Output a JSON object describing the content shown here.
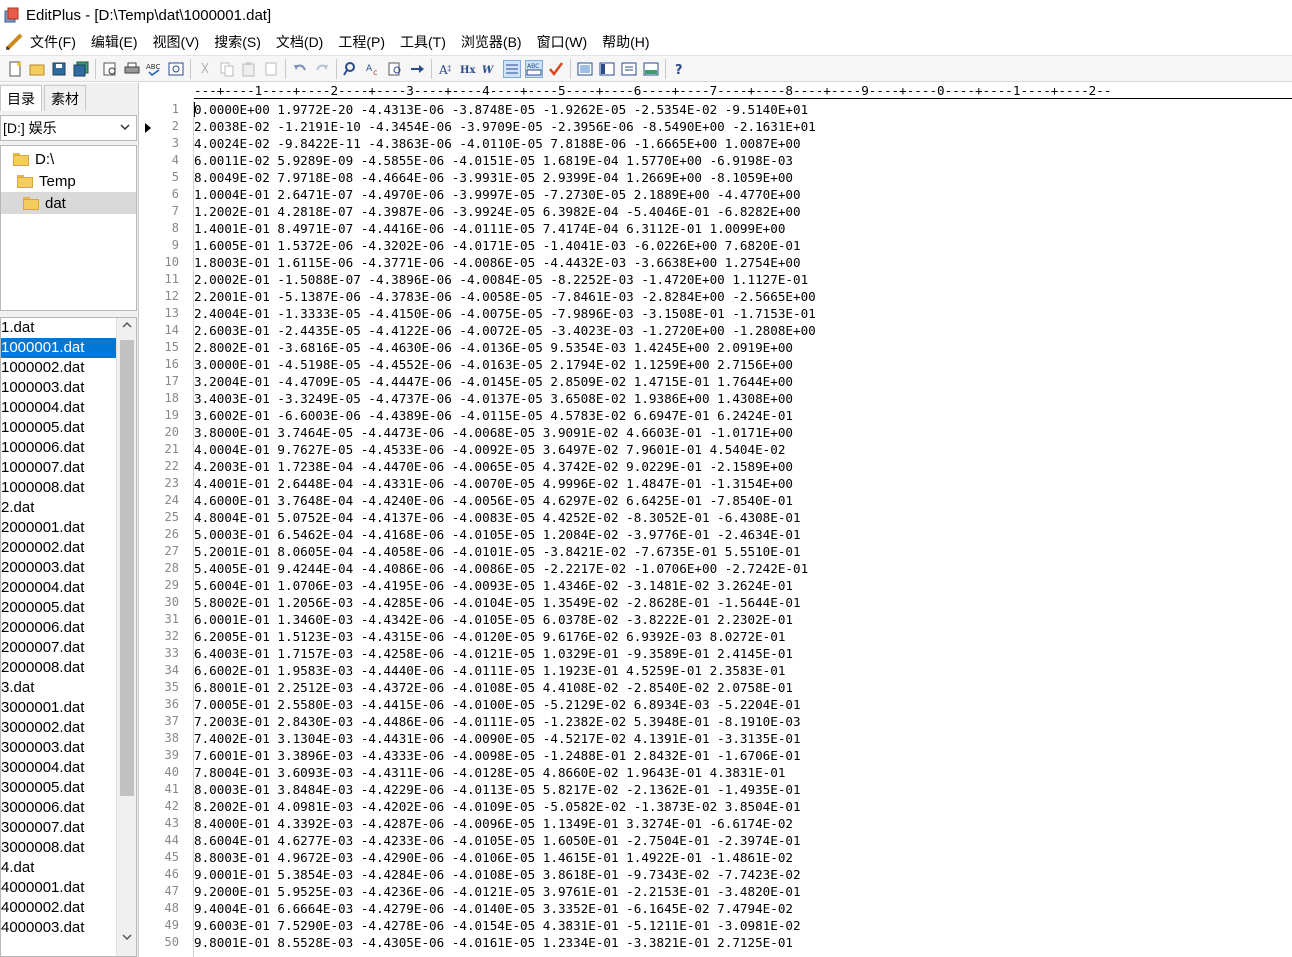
{
  "window": {
    "title": "EditPlus - [D:\\Temp\\dat\\1000001.dat]"
  },
  "menu": [
    "文件(F)",
    "编辑(E)",
    "视图(V)",
    "搜索(S)",
    "文档(D)",
    "工程(P)",
    "工具(T)",
    "浏览器(B)",
    "窗口(W)",
    "帮助(H)"
  ],
  "toolbar": {
    "buttons": [
      "new-icon",
      "open-icon",
      "save-icon",
      "save-all-icon",
      "print-preview-icon",
      "print-icon",
      "spellcheck-icon",
      "browser-icon",
      "cut-icon",
      "copy-icon",
      "paste-icon",
      "delete-icon",
      "undo-icon",
      "redo-icon",
      "find-icon",
      "replace-icon",
      "find-in-files-icon",
      "goto-icon",
      "font-size-icon",
      "hex-icon",
      "word-wrap-icon",
      "line-number-icon",
      "ruler-icon",
      "check-icon",
      "full-screen-icon",
      "directory-icon",
      "cliptext-icon",
      "output-icon",
      "help-icon"
    ]
  },
  "sidebar": {
    "tabs": [
      "目录",
      "素材"
    ],
    "drive": "[D:] 娱乐",
    "tree": [
      "D:\\",
      "Temp",
      "dat"
    ],
    "files": [
      "1.dat",
      "1000001.dat",
      "1000002.dat",
      "1000003.dat",
      "1000004.dat",
      "1000005.dat",
      "1000006.dat",
      "1000007.dat",
      "1000008.dat",
      "2.dat",
      "2000001.dat",
      "2000002.dat",
      "2000003.dat",
      "2000004.dat",
      "2000005.dat",
      "2000006.dat",
      "2000007.dat",
      "2000008.dat",
      "3.dat",
      "3000001.dat",
      "3000002.dat",
      "3000003.dat",
      "3000004.dat",
      "3000005.dat",
      "3000006.dat",
      "3000007.dat",
      "3000008.dat",
      "4.dat",
      "4000001.dat",
      "4000002.dat",
      "4000003.dat"
    ],
    "selected_file": "1000001.dat"
  },
  "editor": {
    "ruler": "---+----1----+----2----+----3----+----4----+----5----+----6----+----7----+----8----+----9----+----0----+----1----+----2--",
    "lines": [
      "0.0000E+00 1.9772E-20 -4.4313E-06 -3.8748E-05 -1.9262E-05 -2.5354E-02 -9.5140E+01",
      "2.0038E-02 -1.2191E-10 -4.3454E-06 -3.9709E-05 -2.3956E-06 -8.5490E+00 -2.1631E+01",
      "4.0024E-02 -9.8422E-11 -4.3863E-06 -4.0110E-05 7.8188E-06 -1.6665E+00 1.0087E+00",
      "6.0011E-02 5.9289E-09 -4.5855E-06 -4.0151E-05 1.6819E-04 1.5770E+00 -6.9198E-03",
      "8.0049E-02 7.9718E-08 -4.4664E-06 -3.9931E-05 2.9399E-04 1.2669E+00 -8.1059E+00",
      "1.0004E-01 2.6471E-07 -4.4970E-06 -3.9997E-05 -7.2730E-05 2.1889E+00 -4.4770E+00",
      "1.2002E-01 4.2818E-07 -4.3987E-06 -3.9924E-05 6.3982E-04 -5.4046E-01 -6.8282E+00",
      "1.4001E-01 8.4971E-07 -4.4416E-06 -4.0111E-05 7.4174E-04 6.3112E-01 1.0099E+00",
      "1.6005E-01 1.5372E-06 -4.3202E-06 -4.0171E-05 -1.4041E-03 -6.0226E+00 7.6820E-01",
      "1.8003E-01 1.6115E-06 -4.3771E-06 -4.0086E-05 -4.4432E-03 -3.6638E+00 1.2754E+00",
      "2.0002E-01 -1.5088E-07 -4.3896E-06 -4.0084E-05 -8.2252E-03 -1.4720E+00 1.1127E-01",
      "2.2001E-01 -5.1387E-06 -4.3783E-06 -4.0058E-05 -7.8461E-03 -2.8284E+00 -2.5665E+00",
      "2.4004E-01 -1.3333E-05 -4.4150E-06 -4.0075E-05 -7.9896E-03 -3.1508E-01 -1.7153E-01",
      "2.6003E-01 -2.4435E-05 -4.4122E-06 -4.0072E-05 -3.4023E-03 -1.2720E+00 -1.2808E+00",
      "2.8002E-01 -3.6816E-05 -4.4630E-06 -4.0136E-05 9.5354E-03 1.4245E+00 2.0919E+00",
      "3.0000E-01 -4.5198E-05 -4.4552E-06 -4.0163E-05 2.1794E-02 1.1259E+00 2.7156E+00",
      "3.2004E-01 -4.4709E-05 -4.4447E-06 -4.0145E-05 2.8509E-02 1.4715E-01 1.7644E+00",
      "3.4003E-01 -3.3249E-05 -4.4737E-06 -4.0137E-05 3.6508E-02 1.9386E+00 1.4308E+00",
      "3.6002E-01 -6.6003E-06 -4.4389E-06 -4.0115E-05 4.5783E-02 6.6947E-01 6.2424E-01",
      "3.8000E-01 3.7464E-05 -4.4473E-06 -4.0068E-05 3.9091E-02 4.6603E-01 -1.0171E+00",
      "4.0004E-01 9.7627E-05 -4.4533E-06 -4.0092E-05 3.6497E-02 7.9601E-01 4.5404E-02",
      "4.2003E-01 1.7238E-04 -4.4470E-06 -4.0065E-05 4.3742E-02 9.0229E-01 -2.1589E+00",
      "4.4001E-01 2.6448E-04 -4.4331E-06 -4.0070E-05 4.9996E-02 1.4847E-01 -1.3154E+00",
      "4.6000E-01 3.7648E-04 -4.4240E-06 -4.0056E-05 4.6297E-02 6.6425E-01 -7.8540E-01",
      "4.8004E-01 5.0752E-04 -4.4137E-06 -4.0083E-05 4.4252E-02 -8.3052E-01 -6.4308E-01",
      "5.0003E-01 6.5462E-04 -4.4168E-06 -4.0105E-05 1.2084E-02 -3.9776E-01 -2.4634E-01",
      "5.2001E-01 8.0605E-04 -4.4058E-06 -4.0101E-05 -3.8421E-02 -7.6735E-01 5.5510E-01",
      "5.4005E-01 9.4244E-04 -4.4086E-06 -4.0086E-05 -2.2217E-02 -1.0706E+00 -2.7242E-01",
      "5.6004E-01 1.0706E-03 -4.4195E-06 -4.0093E-05 1.4346E-02 -3.1481E-02 3.2624E-01",
      "5.8002E-01 1.2056E-03 -4.4285E-06 -4.0104E-05 1.3549E-02 -2.8628E-01 -1.5644E-01",
      "6.0001E-01 1.3460E-03 -4.4342E-06 -4.0105E-05 6.0378E-02 -3.8222E-01 2.2302E-01",
      "6.2005E-01 1.5123E-03 -4.4315E-06 -4.0120E-05 9.6176E-02 6.9392E-03 8.0272E-01",
      "6.4003E-01 1.7157E-03 -4.4258E-06 -4.0121E-05 1.0329E-01 -9.3589E-01 2.4145E-01",
      "6.6002E-01 1.9583E-03 -4.4440E-06 -4.0111E-05 1.1923E-01 4.5259E-01 2.3583E-01",
      "6.8001E-01 2.2512E-03 -4.4372E-06 -4.0108E-05 4.4108E-02 -2.8540E-02 2.0758E-01",
      "7.0005E-01 2.5580E-03 -4.4415E-06 -4.0100E-05 -5.2129E-02 6.8934E-03 -5.2204E-01",
      "7.2003E-01 2.8430E-03 -4.4486E-06 -4.0111E-05 -1.2382E-02 5.3948E-01 -8.1910E-03",
      "7.4002E-01 3.1304E-03 -4.4431E-06 -4.0090E-05 -4.5217E-02 4.1391E-01 -3.3135E-01",
      "7.6001E-01 3.3896E-03 -4.4333E-06 -4.0098E-05 -1.2488E-01 2.8432E-01 -1.6706E-01",
      "7.8004E-01 3.6093E-03 -4.4311E-06 -4.0128E-05 4.8660E-02 1.9643E-01 4.3831E-01",
      "8.0003E-01 3.8484E-03 -4.4229E-06 -4.0113E-05 5.8217E-02 -2.1362E-01 -1.4935E-01",
      "8.2002E-01 4.0981E-03 -4.4202E-06 -4.0109E-05 -5.0582E-02 -1.3873E-02 3.8504E-01",
      "8.4000E-01 4.3392E-03 -4.4287E-06 -4.0096E-05 1.1349E-01 3.3274E-01 -6.6174E-02",
      "8.6004E-01 4.6277E-03 -4.4233E-06 -4.0105E-05 1.6050E-01 -2.7504E-01 -2.3974E-01",
      "8.8003E-01 4.9672E-03 -4.4290E-06 -4.0106E-05 1.4615E-01 1.4922E-01 -1.4861E-02",
      "9.0001E-01 5.3854E-03 -4.4284E-06 -4.0108E-05 3.8618E-01 -9.7343E-02 -7.7423E-02",
      "9.2000E-01 5.9525E-03 -4.4236E-06 -4.0121E-05 3.9761E-01 -2.2153E-01 -3.4820E-01",
      "9.4004E-01 6.6664E-03 -4.4279E-06 -4.0140E-05 3.3352E-01 -6.1645E-02 7.4794E-02",
      "9.6003E-01 7.5290E-03 -4.4278E-06 -4.0154E-05 4.3831E-01 -5.1211E-01 -3.0981E-02",
      "9.8001E-01 8.5528E-03 -4.4305E-06 -4.0161E-05 1.2334E-01 -3.3821E-01 2.7125E-01"
    ]
  }
}
